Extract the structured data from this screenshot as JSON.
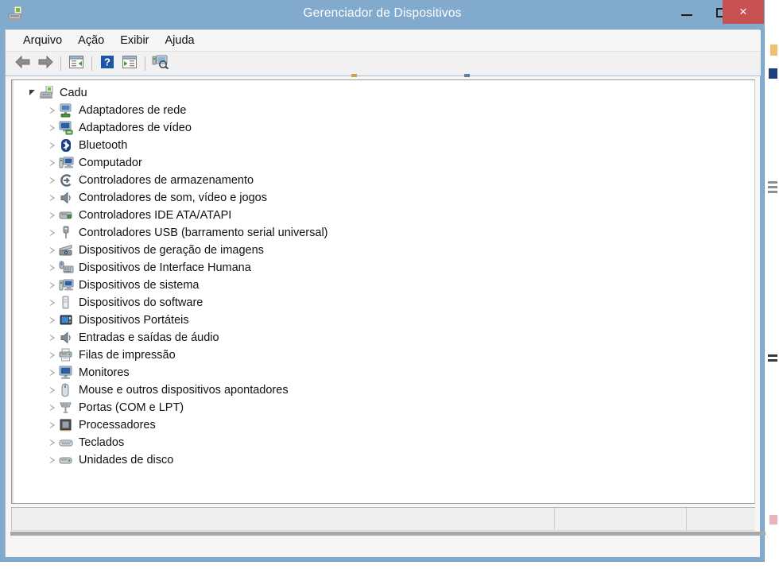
{
  "window": {
    "title": "Gerenciador de Dispositivos",
    "icon": "device-manager-icon",
    "controls": {
      "minimize_label": "—",
      "maximize_label": "□",
      "close_label": "×"
    },
    "colors": {
      "frame": "#81aacd",
      "title_text": "#ffffff",
      "close_button": "#c75050",
      "client": "#f6f6f6",
      "tree_background": "#ffffff",
      "status_bar": "#efefef"
    }
  },
  "menu": {
    "items": [
      {
        "label": "Arquivo",
        "name": "menu-arquivo"
      },
      {
        "label": "Ação",
        "name": "menu-acao"
      },
      {
        "label": "Exibir",
        "name": "menu-exibir"
      },
      {
        "label": "Ajuda",
        "name": "menu-ajuda"
      }
    ]
  },
  "toolbar": {
    "buttons": [
      {
        "icon": "back-arrow-icon",
        "name": "toolbar-back"
      },
      {
        "icon": "forward-arrow-icon",
        "name": "toolbar-forward"
      },
      {
        "icon": "properties-icon",
        "name": "toolbar-properties"
      },
      {
        "icon": "help-icon",
        "name": "toolbar-help"
      },
      {
        "icon": "show-hidden-devices-icon",
        "name": "toolbar-show-hidden"
      },
      {
        "icon": "scan-hardware-changes-icon",
        "name": "toolbar-scan-changes"
      }
    ]
  },
  "tree": {
    "root": {
      "label": "Cadu",
      "icon": "computer-icon",
      "expanded": true
    },
    "nodes": [
      {
        "label": "Adaptadores de rede",
        "icon": "network-adapter-icon"
      },
      {
        "label": "Adaptadores de vídeo",
        "icon": "display-adapter-icon"
      },
      {
        "label": "Bluetooth",
        "icon": "bluetooth-icon"
      },
      {
        "label": "Computador",
        "icon": "computer-node-icon"
      },
      {
        "label": "Controladores de armazenamento",
        "icon": "storage-controller-icon"
      },
      {
        "label": "Controladores de som, vídeo e jogos",
        "icon": "sound-controller-icon"
      },
      {
        "label": "Controladores IDE ATA/ATAPI",
        "icon": "ide-controller-icon"
      },
      {
        "label": "Controladores USB (barramento serial universal)",
        "icon": "usb-controller-icon"
      },
      {
        "label": "Dispositivos de geração de imagens",
        "icon": "imaging-device-icon"
      },
      {
        "label": "Dispositivos de Interface Humana",
        "icon": "hid-device-icon"
      },
      {
        "label": "Dispositivos de sistema",
        "icon": "system-device-icon"
      },
      {
        "label": "Dispositivos do software",
        "icon": "software-device-icon"
      },
      {
        "label": "Dispositivos Portáteis",
        "icon": "portable-device-icon"
      },
      {
        "label": "Entradas e saídas de áudio",
        "icon": "audio-io-icon"
      },
      {
        "label": "Filas de impressão",
        "icon": "print-queue-icon"
      },
      {
        "label": "Monitores",
        "icon": "monitor-icon"
      },
      {
        "label": "Mouse e outros dispositivos apontadores",
        "icon": "mouse-icon"
      },
      {
        "label": "Portas (COM e LPT)",
        "icon": "ports-icon"
      },
      {
        "label": "Processadores",
        "icon": "processor-icon"
      },
      {
        "label": "Teclados",
        "icon": "keyboard-icon"
      },
      {
        "label": "Unidades de disco",
        "icon": "disk-drive-icon"
      }
    ]
  },
  "status_bar": {
    "panes": [
      {
        "text": "",
        "name": "status-pane-main"
      },
      {
        "text": "",
        "name": "status-pane-second"
      },
      {
        "text": "",
        "name": "status-pane-third"
      }
    ]
  }
}
